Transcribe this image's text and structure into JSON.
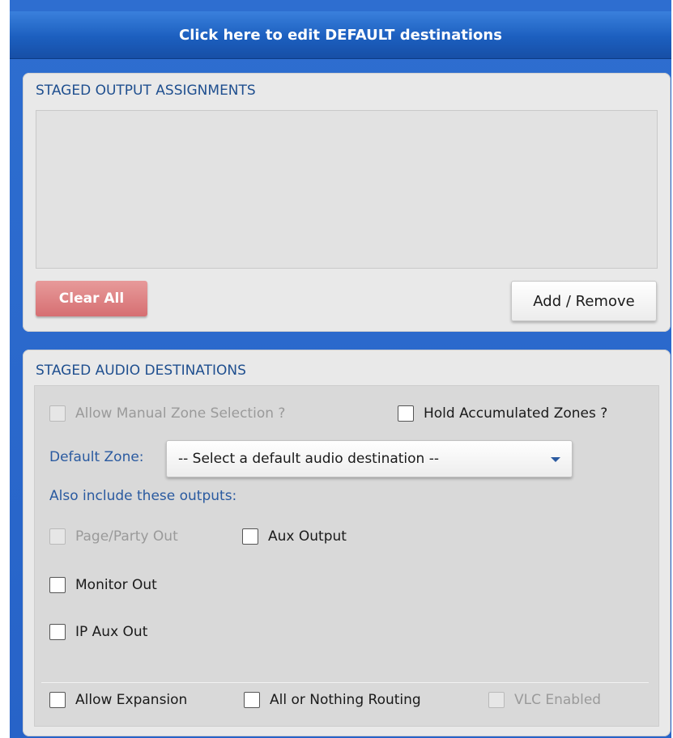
{
  "header": {
    "label": "Click here to edit DEFAULT destinations"
  },
  "output_assignments": {
    "title": "STAGED OUTPUT ASSIGNMENTS",
    "clear_label": "Clear All",
    "add_label": "Add / Remove"
  },
  "audio_destinations": {
    "title": "STAGED AUDIO DESTINATIONS",
    "manual_zone": {
      "label": "Allow Manual Zone Selection ?",
      "checked": false,
      "enabled": false
    },
    "hold_zones": {
      "label": "Hold Accumulated Zones ?",
      "checked": false,
      "enabled": true
    },
    "default_zone_label": "Default Zone:",
    "default_zone_value": "-- Select a default audio destination --",
    "include_label": "Also include these outputs:",
    "page_party": {
      "label": "Page/Party Out",
      "checked": false,
      "enabled": false
    },
    "aux_output": {
      "label": "Aux Output",
      "checked": false,
      "enabled": true
    },
    "monitor_out": {
      "label": "Monitor Out",
      "checked": false,
      "enabled": true
    },
    "ip_aux_out": {
      "label": "IP Aux Out",
      "checked": false,
      "enabled": true
    },
    "allow_expansion": {
      "label": "Allow Expansion",
      "checked": false,
      "enabled": true
    },
    "all_or_nothing": {
      "label": "All or Nothing Routing",
      "checked": false,
      "enabled": true
    },
    "vlc_enabled": {
      "label": "VLC Enabled",
      "checked": false,
      "enabled": false
    }
  },
  "colors": {
    "frame_blue": "#2763c8",
    "header_blue": "#1c5fbf",
    "title_blue": "#1f4f8f",
    "clear_red": "#d66f72",
    "panel_gray": "#e9e9e9"
  }
}
